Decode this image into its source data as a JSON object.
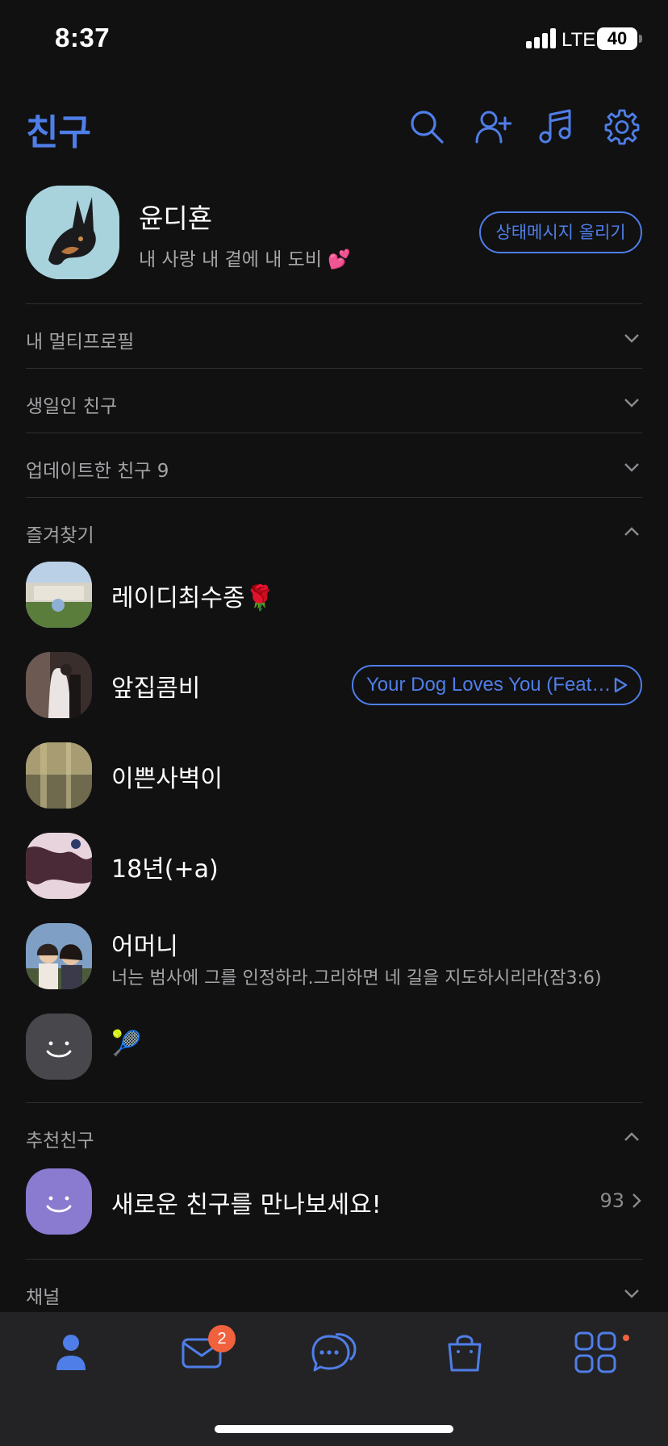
{
  "status_bar": {
    "time": "8:37",
    "network": "LTE",
    "battery": "40"
  },
  "header": {
    "title": "친구"
  },
  "my_profile": {
    "name": "윤디횬",
    "status_message": "내 사랑 내 곁에 내 도비 💕",
    "status_button": "상태메시지 올리기"
  },
  "sections": {
    "multi_profile": "내 멀티프로필",
    "birthday": "생일인 친구",
    "updated": "업데이트한 친구 9",
    "favorites": "즐겨찾기",
    "recommended": "추천친구",
    "channel": "채널"
  },
  "favorites": [
    {
      "name": "레이디최수종🌹",
      "sub": ""
    },
    {
      "name": "앞집콤비",
      "sub": "",
      "music": "Your Dog Loves You (Feat…"
    },
    {
      "name": "이쁜사벽이",
      "sub": ""
    },
    {
      "name": "18년(+a)",
      "sub": ""
    },
    {
      "name": "어머니",
      "sub": "너는 범사에 그를 인정하라.그리하면 네 길을 지도하시리라(잠3:6)"
    },
    {
      "name": "🎾",
      "sub": ""
    }
  ],
  "recommended": {
    "text": "새로운 친구를 만나보세요!",
    "count": "93"
  },
  "tabbar": {
    "chat_badge": "2"
  },
  "colors": {
    "accent": "#4f7ee8",
    "badge": "#f0623e",
    "background": "#111112"
  }
}
